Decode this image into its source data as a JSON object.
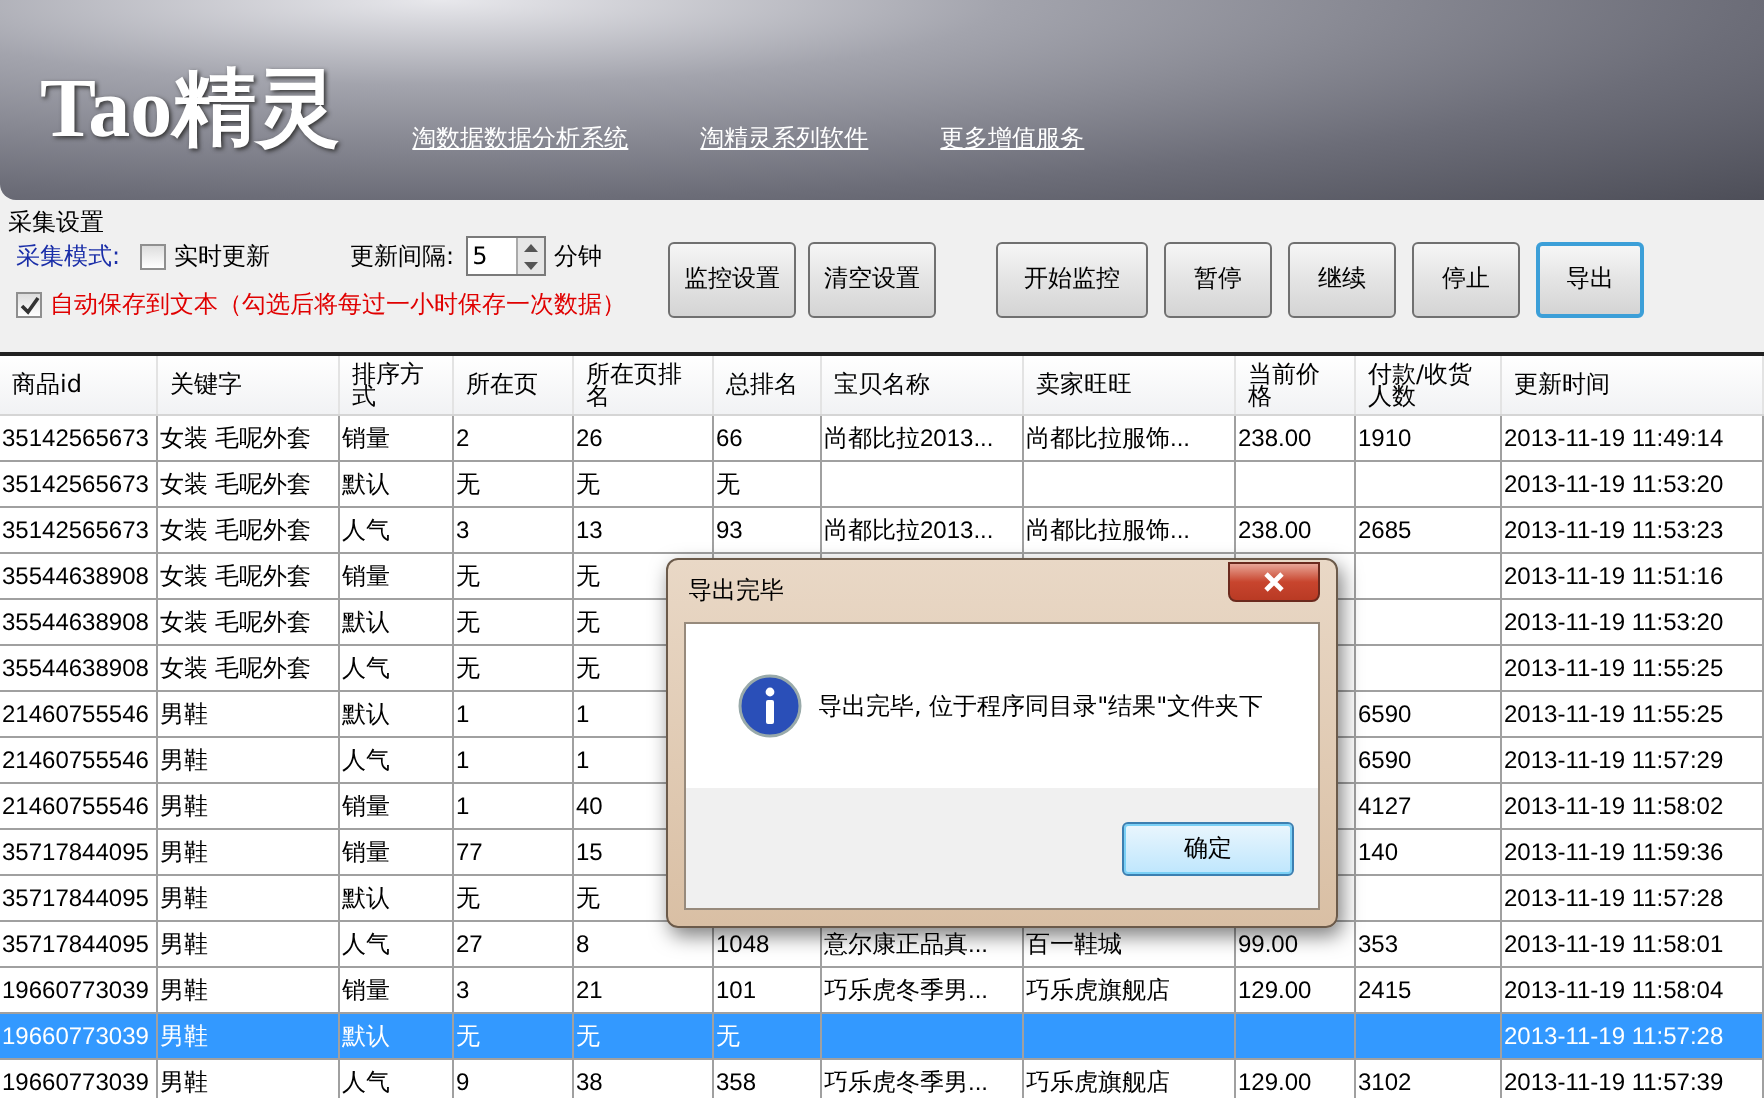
{
  "banner": {
    "logo": "Tao精灵",
    "links": [
      "淘数据数据分析系统",
      "淘精灵系列软件",
      "更多增值服务"
    ]
  },
  "settings": {
    "title": "采集设置",
    "mode_label": "采集模式:",
    "realtime": {
      "label": "实时更新",
      "checked": false
    },
    "interval_label": "更新间隔:",
    "interval_value": "5",
    "interval_unit": "分钟",
    "autosave": {
      "label": "自动保存到文本（勾选后将每过一小时保存一次数据）",
      "checked": true
    },
    "buttons": [
      {
        "label": "监控设置",
        "focused": false
      },
      {
        "label": "清空设置",
        "focused": false
      },
      {
        "label": "开始监控",
        "focused": false
      },
      {
        "label": "暂停",
        "focused": false
      },
      {
        "label": "继续",
        "focused": false
      },
      {
        "label": "停止",
        "focused": false
      },
      {
        "label": "导出",
        "focused": true
      }
    ]
  },
  "table": {
    "columns": [
      "商品id",
      "关键字",
      "排序方式",
      "所在页",
      "所在页排名",
      "总排名",
      "宝贝名称",
      "卖家旺旺",
      "当前价格",
      "付款/收货人数",
      "更新时间"
    ],
    "rows": [
      {
        "selected": false,
        "id": "35142565673",
        "kw": "女装 毛呢外套",
        "sort": "销量",
        "page": "2",
        "pagerank": "26",
        "rank": "66",
        "name": "尚都比拉2013...",
        "seller": "尚都比拉服饰...",
        "price": "238.00",
        "buyers": "1910",
        "time": "2013-11-19 11:49:14"
      },
      {
        "selected": false,
        "id": "35142565673",
        "kw": "女装 毛呢外套",
        "sort": "默认",
        "page": "无",
        "pagerank": "无",
        "rank": "无",
        "time": "2013-11-19 11:53:20"
      },
      {
        "selected": false,
        "id": "35142565673",
        "kw": "女装 毛呢外套",
        "sort": "人气",
        "page": "3",
        "pagerank": "13",
        "rank": "93",
        "name": "尚都比拉2013...",
        "seller": "尚都比拉服饰...",
        "price": "238.00",
        "buyers": "2685",
        "time": "2013-11-19 11:53:23"
      },
      {
        "selected": false,
        "id": "35544638908",
        "kw": "女装 毛呢外套",
        "sort": "销量",
        "page": "无",
        "pagerank": "无",
        "time": "2013-11-19 11:51:16"
      },
      {
        "selected": false,
        "id": "35544638908",
        "kw": "女装 毛呢外套",
        "sort": "默认",
        "page": "无",
        "pagerank": "无",
        "time": "2013-11-19 11:53:20"
      },
      {
        "selected": false,
        "id": "35544638908",
        "kw": "女装 毛呢外套",
        "sort": "人气",
        "page": "无",
        "pagerank": "无",
        "time": "2013-11-19 11:55:25"
      },
      {
        "selected": false,
        "id": "21460755546",
        "kw": "男鞋",
        "sort": "默认",
        "page": "1",
        "pagerank": "1",
        "buyers": "6590",
        "time": "2013-11-19 11:55:25"
      },
      {
        "selected": false,
        "id": "21460755546",
        "kw": "男鞋",
        "sort": "人气",
        "page": "1",
        "pagerank": "1",
        "buyers": "6590",
        "time": "2013-11-19 11:57:29"
      },
      {
        "selected": false,
        "id": "21460755546",
        "kw": "男鞋",
        "sort": "销量",
        "page": "1",
        "pagerank": "40",
        "buyers": "4127",
        "time": "2013-11-19 11:58:02"
      },
      {
        "selected": false,
        "id": "35717844095",
        "kw": "男鞋",
        "sort": "销量",
        "page": "77",
        "pagerank": "15",
        "buyers": "140",
        "time": "2013-11-19 11:59:36"
      },
      {
        "selected": false,
        "id": "35717844095",
        "kw": "男鞋",
        "sort": "默认",
        "page": "无",
        "pagerank": "无",
        "time": "2013-11-19 11:57:28"
      },
      {
        "selected": false,
        "id": "35717844095",
        "kw": "男鞋",
        "sort": "人气",
        "page": "27",
        "pagerank": "8",
        "rank": "1048",
        "name": "意尔康正品真...",
        "seller": "百一鞋城",
        "price": "99.00",
        "buyers": "353",
        "time": "2013-11-19 11:58:01"
      },
      {
        "selected": false,
        "id": "19660773039",
        "kw": "男鞋",
        "sort": "销量",
        "page": "3",
        "pagerank": "21",
        "rank": "101",
        "name": "巧乐虎冬季男...",
        "seller": "巧乐虎旗舰店",
        "price": "129.00",
        "buyers": "2415",
        "time": "2013-11-19 11:58:04"
      },
      {
        "selected": true,
        "id": "19660773039",
        "kw": "男鞋",
        "sort": "默认",
        "page": "无",
        "pagerank": "无",
        "rank": "无",
        "time": "2013-11-19 11:57:28"
      },
      {
        "selected": false,
        "id": "19660773039",
        "kw": "男鞋",
        "sort": "人气",
        "page": "9",
        "pagerank": "38",
        "rank": "358",
        "name": "巧乐虎冬季男...",
        "seller": "巧乐虎旗舰店",
        "price": "129.00",
        "buyers": "3102",
        "time": "2013-11-19 11:57:39"
      }
    ]
  },
  "dialog": {
    "title": "导出完毕",
    "message": "导出完毕, 位于程序同目录\"结果\"文件夹下",
    "button": "确定"
  }
}
